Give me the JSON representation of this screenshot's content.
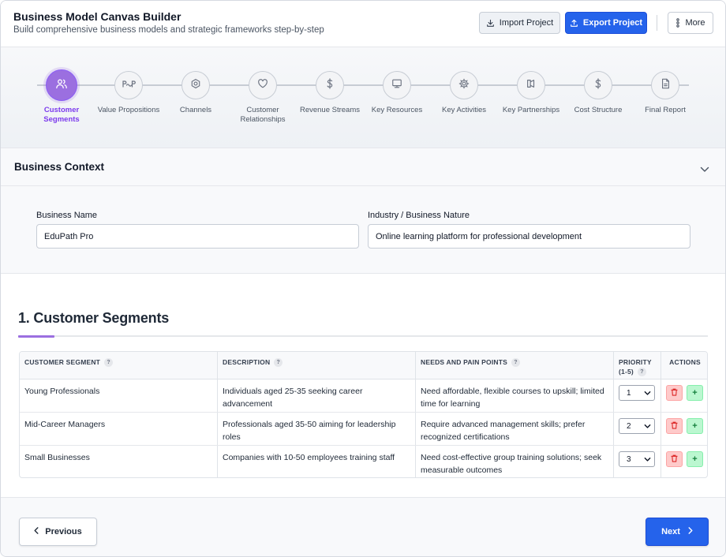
{
  "header": {
    "title": "Business Model Canvas Builder",
    "subtitle": "Build comprehensive business models and strategic frameworks step-by-step",
    "import_label": "Import Project",
    "export_label": "Export Project",
    "more_label": "More"
  },
  "steps": [
    {
      "label": "Customer Segments",
      "icon": "users-icon",
      "active": true
    },
    {
      "label": "Value Propositions",
      "icon": "value-prop-icon",
      "active": false
    },
    {
      "label": "Channels",
      "icon": "channels-icon",
      "active": false
    },
    {
      "label": "Customer Relationships",
      "icon": "heart-icon",
      "active": false
    },
    {
      "label": "Revenue Streams",
      "icon": "dollar-icon",
      "active": false
    },
    {
      "label": "Key Resources",
      "icon": "monitor-icon",
      "active": false
    },
    {
      "label": "Key Activities",
      "icon": "gear-icon",
      "active": false
    },
    {
      "label": "Key Partnerships",
      "icon": "partnership-icon",
      "active": false
    },
    {
      "label": "Cost Structure",
      "icon": "dollar-icon",
      "active": false
    },
    {
      "label": "Final Report",
      "icon": "document-icon",
      "active": false
    }
  ],
  "context": {
    "title": "Business Context",
    "business_name_label": "Business Name",
    "business_name_value": "EduPath Pro",
    "industry_label": "Industry / Business Nature",
    "industry_value": "Online learning platform for professional development"
  },
  "segments": {
    "title": "1. Customer Segments",
    "columns": {
      "segment": "CUSTOMER SEGMENT",
      "description": "DESCRIPTION",
      "needs": "NEEDS AND PAIN POINTS",
      "priority": "PRIORITY (1-5)",
      "actions": "ACTIONS"
    },
    "help_glyph": "?",
    "add_glyph": "+",
    "rows": [
      {
        "segment": "Young Professionals",
        "description": "Individuals aged 25-35 seeking career advancement",
        "needs": "Need affordable, flexible courses to upskill; limited time for learning",
        "priority": "1"
      },
      {
        "segment": "Mid-Career Managers",
        "description": "Professionals aged 35-50 aiming for leadership roles",
        "needs": "Require advanced management skills; prefer recognized certifications",
        "priority": "2"
      },
      {
        "segment": "Small Businesses",
        "description": "Companies with 10-50 employees training staff",
        "needs": "Need cost-effective group training solutions; seek measurable outcomes",
        "priority": "3"
      }
    ]
  },
  "footer": {
    "previous_label": "Previous",
    "next_label": "Next"
  },
  "colors": {
    "accent_purple": "#9b6fe0",
    "primary_blue": "#2563eb",
    "delete_red": "#fecaca",
    "add_green": "#bbf7d0"
  }
}
